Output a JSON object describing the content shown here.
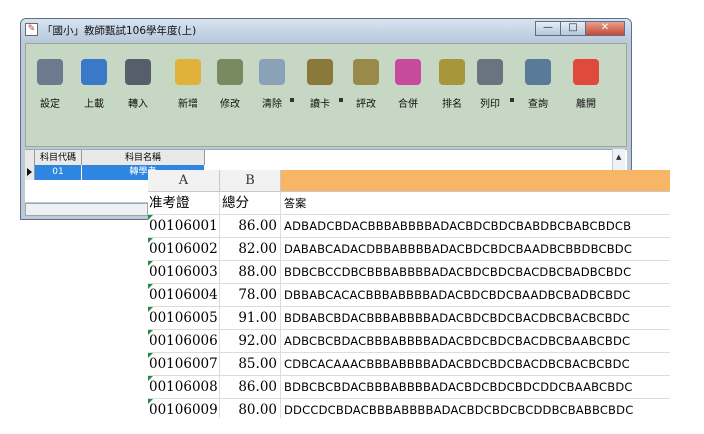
{
  "window": {
    "title": "「國小」教師甄試106學年度(上)",
    "controls": {
      "minimize": "—",
      "maximize": "□",
      "close": "✕"
    }
  },
  "toolbar": {
    "items": [
      {
        "id": "settings",
        "label": "設定",
        "icon": "calculator-icon",
        "color": "#6b7a8c"
      },
      {
        "id": "upload",
        "label": "上載",
        "icon": "upload-icon",
        "color": "#3a78c8"
      },
      {
        "id": "import",
        "label": "轉入",
        "icon": "printer-import-icon",
        "color": "#555e6a"
      },
      {
        "id": "add",
        "label": "新增",
        "icon": "folder-add-icon",
        "color": "#e0b23a"
      },
      {
        "id": "edit",
        "label": "修改",
        "icon": "pencil-check-icon",
        "color": "#7a8a60"
      },
      {
        "id": "clear",
        "label": "清除",
        "icon": "trash-icon",
        "color": "#8aa2b8"
      },
      {
        "id": "read-card",
        "label": "讀卡",
        "icon": "card-reader-icon",
        "color": "#8a7a3a"
      },
      {
        "id": "grade",
        "label": "評改",
        "icon": "grading-icon",
        "color": "#9a8a4a"
      },
      {
        "id": "merge",
        "label": "合併",
        "icon": "merge-icon",
        "color": "#c84a9a"
      },
      {
        "id": "rank",
        "label": "排名",
        "icon": "rank-icon",
        "color": "#a8963a"
      },
      {
        "id": "print",
        "label": "列印",
        "icon": "printer-icon",
        "color": "#6a7480"
      },
      {
        "id": "query",
        "label": "查詢",
        "icon": "magnifier-icon",
        "color": "#5a7a9a"
      },
      {
        "id": "exit",
        "label": "離開",
        "icon": "power-icon",
        "color": "#e04a3a"
      }
    ]
  },
  "subjects": {
    "headers": [
      "科目代碼",
      "科目名稱"
    ],
    "rows": [
      {
        "code": "01",
        "name": "轉學考"
      }
    ]
  },
  "spreadsheet": {
    "columns": [
      "A",
      "B",
      ""
    ],
    "header": {
      "a": "准考證",
      "b": "總分",
      "c": "答案"
    },
    "rows": [
      {
        "a": "00106001",
        "b": "86.00",
        "c": "ADBADCBDACBBBABBBBADACBDCBDCBABDBCBABCBDCB"
      },
      {
        "a": "00106002",
        "b": "82.00",
        "c": "DABABCADACDBBABBBBADACBDCBDCBAADBCBBDBCBDC"
      },
      {
        "a": "00106003",
        "b": "88.00",
        "c": "BDBCBCCDBCBBBABBBBADACBDCBDCBACDBCBADBCBDC"
      },
      {
        "a": "00106004",
        "b": "78.00",
        "c": "DBBABCACACBBBABBBBADACBDCBDCBAADBCBADBCBDC"
      },
      {
        "a": "00106005",
        "b": "91.00",
        "c": "BDBABCBDACBBBABBBBADACBDCBDCBACDBCBACBCBDC"
      },
      {
        "a": "00106006",
        "b": "92.00",
        "c": "ADBCBCBDACBBBABBBBADACBDCBDCBACDBCBAABCBDC"
      },
      {
        "a": "00106007",
        "b": "85.00",
        "c": "CDBCACAAACBBBABBBBADACBDCBDCBACDBCBACBCBDC"
      },
      {
        "a": "00106008",
        "b": "86.00",
        "c": "BDBCBCBDACBBBABBBBADACBDCBDCBDCDDCBAABCBDC"
      },
      {
        "a": "00106009",
        "b": "80.00",
        "c": "DDCCDCBDACBBBABBBBADACBDCBDCBCDDBCBABBCBDC"
      }
    ]
  }
}
